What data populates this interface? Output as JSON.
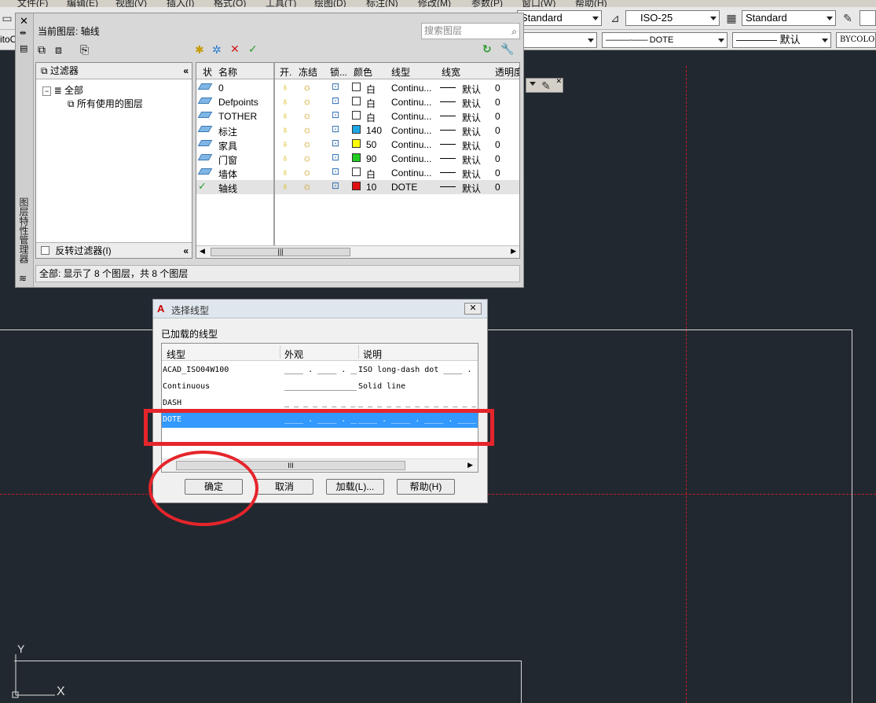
{
  "menu": [
    "文件(F)",
    "编辑(E)",
    "视图(V)",
    "插入(I)",
    "格式(O)",
    "工具(T)",
    "绘图(D)",
    "标注(N)",
    "修改(M)",
    "参数(P)",
    "窗口(W)",
    "帮助(H)"
  ],
  "toolbar": {
    "text_style": "Standard",
    "dim_style": "ISO-25",
    "table_style": "Standard",
    "linetype": "DOTE",
    "lineweight": "默认",
    "color": "BYCOLOR",
    "left_fragment": "itoC"
  },
  "layer_manager": {
    "side_title": "图层特性管理器",
    "current_layer_label": "当前图层: 轴线",
    "search_placeholder": "搜索图层",
    "filter_header": "过滤器",
    "filter_tree": [
      "全部",
      "所有使用的图层"
    ],
    "invert_filter_label": "反转过滤器(I)",
    "columns": [
      "状",
      "名称",
      "开.",
      "冻结",
      "锁...",
      "颜色",
      "线型",
      "线宽",
      "透明度"
    ],
    "rows": [
      {
        "name": "0",
        "color_name": "白",
        "color_hex": "#ffffff",
        "linetype": "Continu...",
        "lineweight": "默认",
        "transparency": "0",
        "current": false
      },
      {
        "name": "Defpoints",
        "color_name": "白",
        "color_hex": "#ffffff",
        "linetype": "Continu...",
        "lineweight": "默认",
        "transparency": "0",
        "current": false
      },
      {
        "name": "TOTHER",
        "color_name": "白",
        "color_hex": "#ffffff",
        "linetype": "Continu...",
        "lineweight": "默认",
        "transparency": "0",
        "current": false
      },
      {
        "name": "标注",
        "color_name": "140",
        "color_hex": "#1fa7e6",
        "linetype": "Continu...",
        "lineweight": "默认",
        "transparency": "0",
        "current": false
      },
      {
        "name": "家具",
        "color_name": "50",
        "color_hex": "#ffff00",
        "linetype": "Continu...",
        "lineweight": "默认",
        "transparency": "0",
        "current": false
      },
      {
        "name": "门窗",
        "color_name": "90",
        "color_hex": "#22cc22",
        "linetype": "Continu...",
        "lineweight": "默认",
        "transparency": "0",
        "current": false
      },
      {
        "name": "墙体",
        "color_name": "白",
        "color_hex": "#ffffff",
        "linetype": "Continu...",
        "lineweight": "默认",
        "transparency": "0",
        "current": false
      },
      {
        "name": "轴线",
        "color_name": "10",
        "color_hex": "#e01010",
        "linetype": "DOTE",
        "lineweight": "默认",
        "transparency": "0",
        "current": true
      }
    ],
    "status": "全部: 显示了 8 个图层，共 8 个图层"
  },
  "dialog": {
    "title": "选择线型",
    "close_label": "✕",
    "loaded_label": "已加载的线型",
    "columns": [
      "线型",
      "外观",
      "说明"
    ],
    "rows": [
      {
        "name": "ACAD_ISO04W100",
        "appearance": "____ . ____ . ____ . ____",
        "description": "ISO long-dash dot ____ . ___",
        "selected": false
      },
      {
        "name": "Continuous",
        "appearance": "______________________",
        "description": "Solid line",
        "selected": false
      },
      {
        "name": "DASH",
        "appearance": "_ _ _ _ _ _ _ _ _ _ _",
        "description": "_ _ _ _ _ _ _ _ _ _ _ _ _",
        "selected": false
      },
      {
        "name": "DOTE",
        "appearance": "____ . ____ . ____ . ____",
        "description": "____ . ____ . ____ . ____",
        "selected": true
      }
    ],
    "scroll_grip": "III",
    "buttons": {
      "ok": "确定",
      "cancel": "取消",
      "load": "加载(L)...",
      "help": "帮助(H)"
    }
  },
  "ucs": {
    "x": "X",
    "y": "Y"
  },
  "colors": {
    "annotation": "#e5252b",
    "selection": "#3399ff",
    "canvas": "#212830",
    "axis_line": "#c81e1e"
  }
}
